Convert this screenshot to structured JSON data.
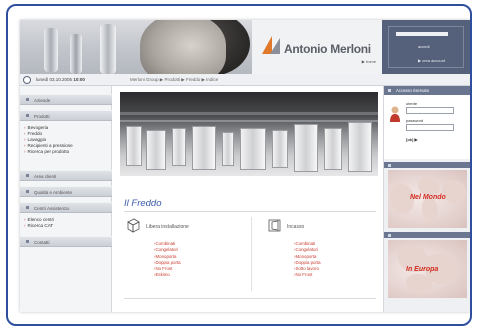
{
  "header": {
    "brand_name": "Antonio Merloni",
    "brand_link": "▶ home",
    "login_label": "accedi",
    "login_sub": "▶ crea account"
  },
  "datebar": {
    "date": "lunedì 03.10.2005",
    "time": "10:00",
    "breadcrumb": "Merloni Group ▶ Prodotti ▶ Freddo ▶ Indice"
  },
  "nav": {
    "btn1": "Aziende",
    "btn2": "Prodotti",
    "list1": [
      "Bevogeria",
      "Freddo",
      "Lavaggio",
      "Recipienti a pressione",
      "Ricerca per prodotto"
    ],
    "btn3": "Area clienti",
    "btn4": "Qualità e Ambiente",
    "btn5": "Centri Assistenza",
    "list2": [
      "Elenco centri",
      "Ricerca CAT"
    ],
    "btn6": "Contatti"
  },
  "main": {
    "title": "Il Freddo",
    "cat1": {
      "title": "Libera installazione",
      "items": [
        "Combinati",
        "Congelatori",
        "Monoporta",
        "Doppia porta",
        "No Frost",
        "Eskimo"
      ]
    },
    "cat2": {
      "title": "Incasso",
      "items": [
        "Combinati",
        "Congelatori",
        "Monoporta",
        "Doppia porta",
        "Sotto lavoro",
        "No Frost"
      ]
    }
  },
  "right": {
    "login_head": "Accesso riservato",
    "user_label": "utente",
    "pass_label": "password",
    "go_label": "[ok] ▶",
    "map1_label": "Nel Mondo",
    "map2_label": "In Europa"
  },
  "colors": {
    "frame_border": "#2f4f9e",
    "link_red": "#c83a2c",
    "title_blue": "#3a5ba9",
    "panel_slate": "#6a7590"
  }
}
